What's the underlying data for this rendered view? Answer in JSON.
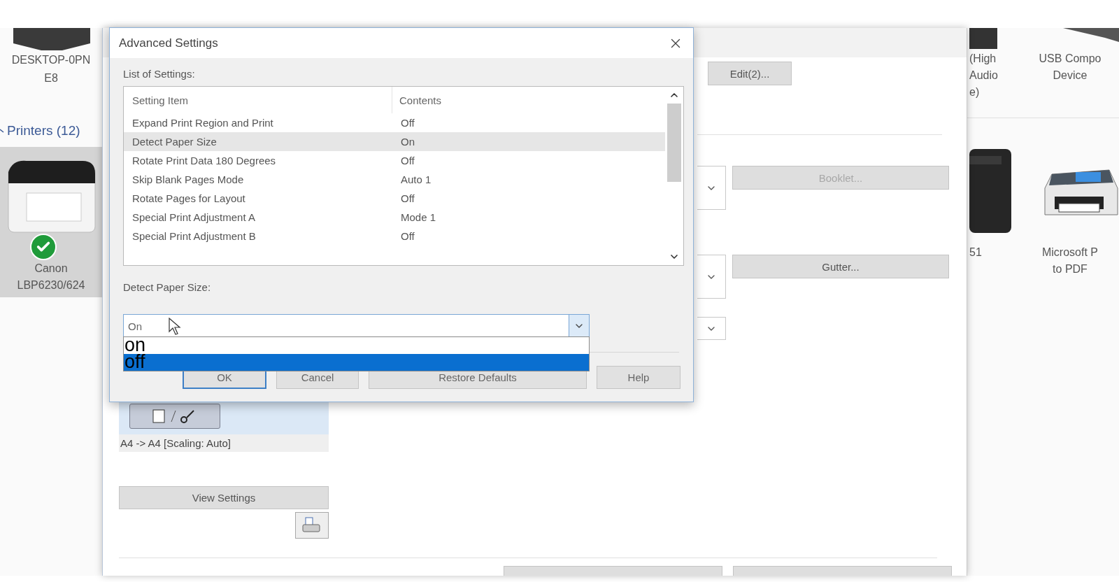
{
  "explorer": {
    "left_devices": [
      {
        "label_lines": [
          "DESKTOP-0PN",
          "E8"
        ]
      }
    ],
    "group": {
      "label": "Printers (12)"
    },
    "left_printers": [
      {
        "label_lines": [
          "Canon",
          "LBP6230/624"
        ],
        "selected": true,
        "default": true
      }
    ],
    "right_devices": [
      {
        "label_lines": [
          "(High",
          "Audio",
          "e)"
        ]
      },
      {
        "label_lines": [
          "USB Compo",
          "Device"
        ]
      }
    ],
    "right_printers": [
      {
        "label_lines": [
          "51"
        ],
        "kind": "laser"
      },
      {
        "label_lines": [
          "Microsoft P",
          "to PDF"
        ],
        "kind": "inkjet"
      }
    ]
  },
  "properties": {
    "edit_button": "Edit(2)...",
    "side_buttons": [
      {
        "label": "Booklet...",
        "disabled": true
      },
      {
        "label": "Gutter...",
        "disabled": false
      }
    ],
    "layout_caption": "A4 -> A4 [Scaling: Auto]",
    "view_settings": "View Settings"
  },
  "dialog": {
    "title": "Advanced Settings",
    "list_label": "List of Settings:",
    "columns": [
      "Setting Item",
      "Contents"
    ],
    "rows": [
      {
        "item": "Expand Print Region and Print",
        "contents": "Off",
        "selected": false
      },
      {
        "item": "Detect Paper Size",
        "contents": "On",
        "selected": true
      },
      {
        "item": "Rotate Print Data 180 Degrees",
        "contents": "Off",
        "selected": false
      },
      {
        "item": "Skip Blank Pages Mode",
        "contents": "Auto 1",
        "selected": false
      },
      {
        "item": "Rotate Pages for Layout",
        "contents": "Off",
        "selected": false
      },
      {
        "item": "Special Print Adjustment A",
        "contents": "Mode 1",
        "selected": false
      },
      {
        "item": "Special Print Adjustment B",
        "contents": "Off",
        "selected": false
      }
    ],
    "value_label": "Detect Paper Size:",
    "combo": {
      "value": "On",
      "expanded": true,
      "options": [
        {
          "label": "on",
          "selected": false
        },
        {
          "label": "off",
          "selected": true
        }
      ]
    },
    "buttons": [
      {
        "label": "OK",
        "default": true
      },
      {
        "label": "Cancel",
        "default": false
      },
      {
        "label": "Restore Defaults",
        "default": false
      },
      {
        "label": "Help",
        "default": false
      }
    ]
  }
}
